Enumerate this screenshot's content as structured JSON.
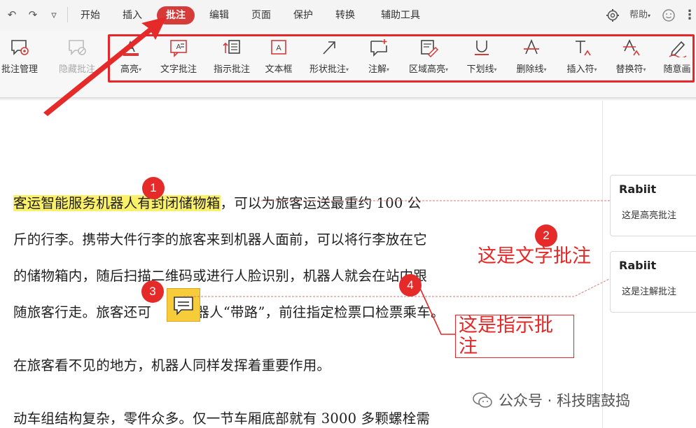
{
  "menubar": {
    "tabs": [
      {
        "label": "开始"
      },
      {
        "label": "插入"
      },
      {
        "label": "批注"
      },
      {
        "label": "编辑"
      },
      {
        "label": "页面"
      },
      {
        "label": "保护"
      },
      {
        "label": "转换"
      },
      {
        "label": "辅助工具"
      }
    ],
    "active_tab": "批注",
    "help_label": "帮助"
  },
  "ribbon": {
    "left_tools": [
      {
        "label": "批注管理",
        "icon": "comment-gear-icon",
        "enabled": true
      },
      {
        "label": "隐藏批注",
        "icon": "comment-hide-icon",
        "enabled": false
      }
    ],
    "tools": [
      {
        "label": "高亮",
        "icon": "highlight-icon",
        "dropdown": true
      },
      {
        "label": "文字批注",
        "icon": "text-comment-icon",
        "dropdown": false
      },
      {
        "label": "指示批注",
        "icon": "pointer-comment-icon",
        "dropdown": false
      },
      {
        "label": "文本框",
        "icon": "textbox-icon",
        "dropdown": false
      },
      {
        "label": "形状批注",
        "icon": "shape-arrow-icon",
        "dropdown": true
      },
      {
        "label": "注解",
        "icon": "note-add-icon",
        "dropdown": true
      },
      {
        "label": "区域高亮",
        "icon": "area-highlight-icon",
        "dropdown": true
      },
      {
        "label": "下划线",
        "icon": "underline-icon",
        "dropdown": true
      },
      {
        "label": "删除线",
        "icon": "strikethrough-icon",
        "dropdown": true
      },
      {
        "label": "插入符",
        "icon": "insert-caret-icon",
        "dropdown": true
      },
      {
        "label": "替换符",
        "icon": "replace-caret-icon",
        "dropdown": true
      },
      {
        "label": "随意画",
        "icon": "freehand-pen-icon",
        "dropdown": false
      }
    ]
  },
  "document": {
    "line1_highlighted": "客运智能服务机器人有封闭储物箱",
    "line1_rest": "，可以为旅客运送最重约 100 公",
    "line2": "斤的行李。携带大件行李的旅客来到机器人面前，可以将行李放在它",
    "line3": "的储物箱内，随后扫描二维码或进行人脸识别，机器人就会在站内跟",
    "line4_before": "随旅客行走。旅客还可",
    "line4_after": "让机器人“带路”，前往指定检票口检票乘车。",
    "line5": "在旅客看不见的地方，机器人同样发挥着重要作用。",
    "line6": "动车组结构复杂，零件众多。仅一节车厢底部就有 3000 多颗螺栓需"
  },
  "comments": [
    {
      "author": "Rabiit",
      "text": "这是高亮批注"
    },
    {
      "author": "Rabiit",
      "text": "这是注解批注"
    }
  ],
  "annotations": {
    "badges": [
      "1",
      "2",
      "3",
      "4"
    ],
    "text_comment": "这是文字批注",
    "pointer_comment": "这是指示批注"
  },
  "watermark": {
    "text": "公众号 · 科技瞎鼓捣"
  },
  "colors": {
    "accent_red": "#e52727",
    "active_tab": "#d43b39",
    "highlight_yellow": "#fbf06a",
    "note_yellow": "#f6cc3a"
  }
}
